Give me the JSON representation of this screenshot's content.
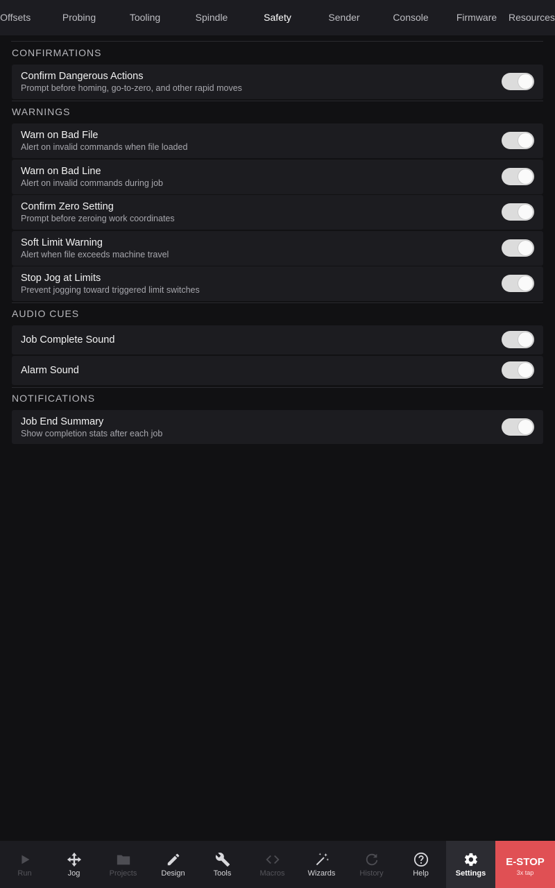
{
  "top_tabs": [
    {
      "label": "Work Offsets"
    },
    {
      "label": "Probing"
    },
    {
      "label": "Tooling"
    },
    {
      "label": "Spindle"
    },
    {
      "label": "Safety",
      "active": true
    },
    {
      "label": "Sender"
    },
    {
      "label": "Console"
    },
    {
      "label": "Firmware"
    },
    {
      "label": "Resources"
    }
  ],
  "sections": {
    "confirmations": {
      "title": "CONFIRMATIONS",
      "items": [
        {
          "title": "Confirm Dangerous Actions",
          "subtitle": "Prompt before homing, go-to-zero, and other rapid moves",
          "enabled": true
        }
      ]
    },
    "warnings": {
      "title": "WARNINGS",
      "items": [
        {
          "title": "Warn on Bad File",
          "subtitle": "Alert on invalid commands when file loaded",
          "enabled": true
        },
        {
          "title": "Warn on Bad Line",
          "subtitle": "Alert on invalid commands during job",
          "enabled": true
        },
        {
          "title": "Confirm Zero Setting",
          "subtitle": "Prompt before zeroing work coordinates",
          "enabled": true
        },
        {
          "title": "Soft Limit Warning",
          "subtitle": "Alert when file exceeds machine travel",
          "enabled": true
        },
        {
          "title": "Stop Jog at Limits",
          "subtitle": "Prevent jogging toward triggered limit switches",
          "enabled": true
        }
      ]
    },
    "audio": {
      "title": "AUDIO CUES",
      "items": [
        {
          "title": "Job Complete Sound",
          "enabled": true
        },
        {
          "title": "Alarm Sound",
          "enabled": true
        }
      ]
    },
    "notifications": {
      "title": "NOTIFICATIONS",
      "items": [
        {
          "title": "Job End Summary",
          "subtitle": "Show completion stats after each job",
          "enabled": true
        }
      ]
    }
  },
  "bottom_nav": [
    {
      "label": "Run",
      "icon": "play-icon",
      "disabled": true
    },
    {
      "label": "Jog",
      "icon": "move-arrows-icon"
    },
    {
      "label": "Projects",
      "icon": "folder-icon",
      "disabled": true
    },
    {
      "label": "Design",
      "icon": "pencil-icon"
    },
    {
      "label": "Tools",
      "icon": "wrench-icon"
    },
    {
      "label": "Macros",
      "icon": "code-brackets-icon",
      "disabled": true
    },
    {
      "label": "Wizards",
      "icon": "magic-wand-icon"
    },
    {
      "label": "History",
      "icon": "refresh-icon",
      "disabled": true
    },
    {
      "label": "Help",
      "icon": "help-circle-icon"
    },
    {
      "label": "Settings",
      "icon": "gear-icon",
      "active": true
    }
  ],
  "estop": {
    "label": "E-STOP",
    "hint": "3x tap",
    "color": "#e05054"
  },
  "colors": {
    "background": "#111113",
    "panel": "#1c1c20",
    "accent": "#e05054"
  }
}
